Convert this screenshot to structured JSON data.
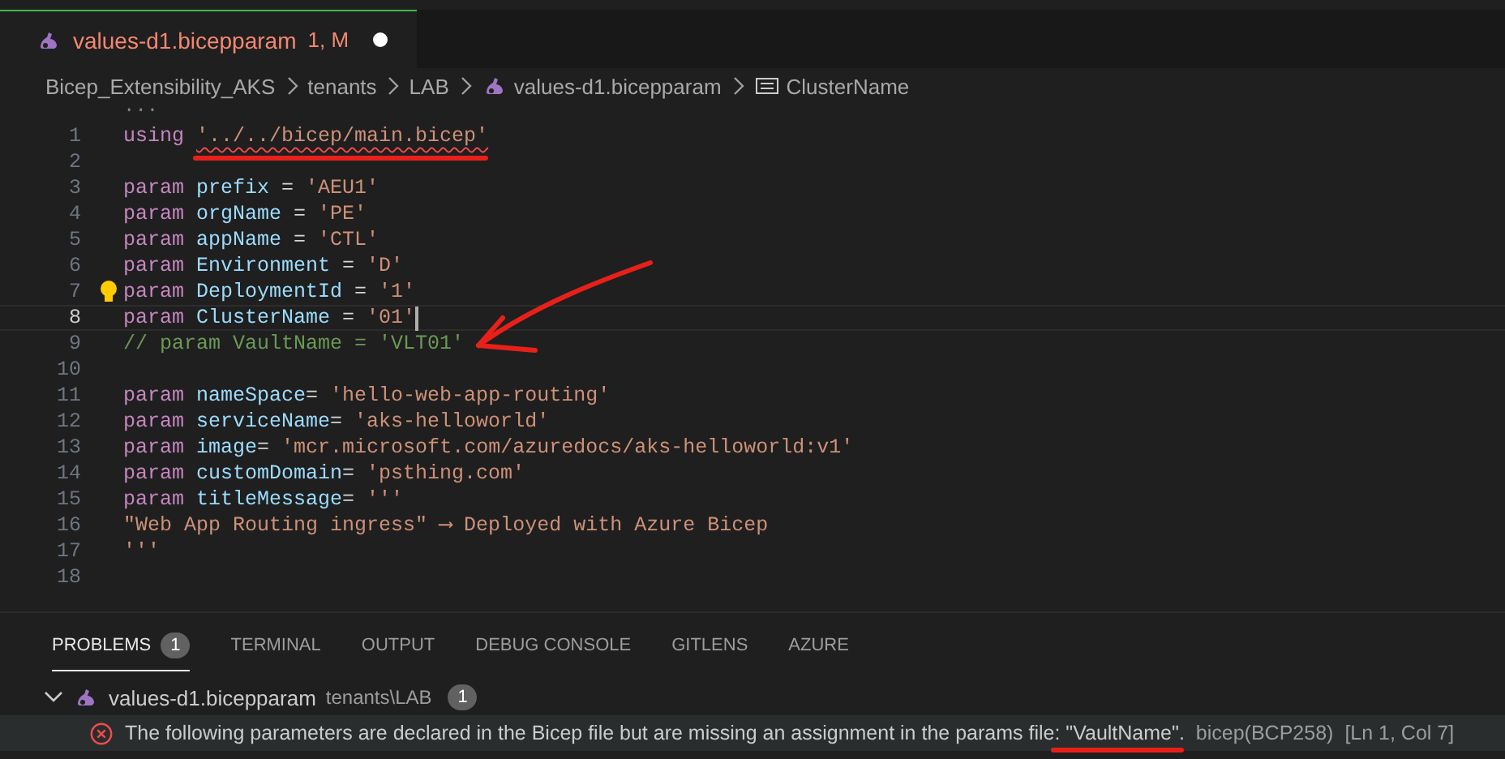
{
  "tabs": [
    {
      "label": "values-d1.bicepparam",
      "status": "1, M",
      "unsaved": true,
      "selected": true
    }
  ],
  "breadcrumb": [
    {
      "label": "Bicep_Extensibility_AKS",
      "kind": "folder"
    },
    {
      "label": "tenants",
      "kind": "folder"
    },
    {
      "label": "LAB",
      "kind": "folder"
    },
    {
      "label": "values-d1.bicepparam",
      "kind": "file"
    },
    {
      "label": "ClusterName",
      "kind": "symbol"
    }
  ],
  "editor": {
    "fold_marker": "···",
    "lines": [
      {
        "number": "1",
        "tokens": [
          {
            "kind": "keyword",
            "text": "using "
          },
          {
            "kind": "string",
            "text": "'../../bicep/main.bicep'",
            "error": true
          }
        ]
      },
      {
        "number": "2"
      },
      {
        "number": "3",
        "tokens": [
          {
            "kind": "keyword",
            "text": "param "
          },
          {
            "kind": "ident",
            "text": "prefix"
          },
          {
            "kind": "plain",
            "text": " = "
          },
          {
            "kind": "string",
            "text": "'AEU1'"
          }
        ]
      },
      {
        "number": "4",
        "tokens": [
          {
            "kind": "keyword",
            "text": "param "
          },
          {
            "kind": "ident",
            "text": "orgName"
          },
          {
            "kind": "plain",
            "text": " = "
          },
          {
            "kind": "string",
            "text": "'PE'"
          }
        ]
      },
      {
        "number": "5",
        "tokens": [
          {
            "kind": "keyword",
            "text": "param "
          },
          {
            "kind": "ident",
            "text": "appName"
          },
          {
            "kind": "plain",
            "text": " = "
          },
          {
            "kind": "string",
            "text": "'CTL'"
          }
        ]
      },
      {
        "number": "6",
        "tokens": [
          {
            "kind": "keyword",
            "text": "param "
          },
          {
            "kind": "ident",
            "text": "Environment"
          },
          {
            "kind": "plain",
            "text": " = "
          },
          {
            "kind": "string",
            "text": "'D'"
          }
        ]
      },
      {
        "number": "7",
        "lightbulb": true,
        "tokens": [
          {
            "kind": "keyword",
            "text": "param "
          },
          {
            "kind": "ident",
            "text": "DeploymentId"
          },
          {
            "kind": "plain",
            "text": " = "
          },
          {
            "kind": "string",
            "text": "'1'"
          }
        ]
      },
      {
        "number": "8",
        "current": true,
        "tokens": [
          {
            "kind": "keyword",
            "text": "param "
          },
          {
            "kind": "ident",
            "text": "ClusterName"
          },
          {
            "kind": "plain",
            "text": " = "
          },
          {
            "kind": "string",
            "text": "'01'"
          }
        ]
      },
      {
        "number": "9",
        "tokens": [
          {
            "kind": "comment",
            "text": "// param VaultName = 'VLT01'"
          }
        ]
      },
      {
        "number": "10"
      },
      {
        "number": "11",
        "tokens": [
          {
            "kind": "keyword",
            "text": "param "
          },
          {
            "kind": "ident",
            "text": "nameSpace"
          },
          {
            "kind": "plain",
            "text": "= "
          },
          {
            "kind": "string",
            "text": "'hello-web-app-routing'"
          }
        ]
      },
      {
        "number": "12",
        "tokens": [
          {
            "kind": "keyword",
            "text": "param "
          },
          {
            "kind": "ident",
            "text": "serviceName"
          },
          {
            "kind": "plain",
            "text": "= "
          },
          {
            "kind": "string",
            "text": "'aks-helloworld'"
          }
        ]
      },
      {
        "number": "13",
        "tokens": [
          {
            "kind": "keyword",
            "text": "param "
          },
          {
            "kind": "ident",
            "text": "image"
          },
          {
            "kind": "plain",
            "text": "= "
          },
          {
            "kind": "string",
            "text": "'mcr.microsoft.com/azuredocs/aks-helloworld:v1'"
          }
        ]
      },
      {
        "number": "14",
        "tokens": [
          {
            "kind": "keyword",
            "text": "param "
          },
          {
            "kind": "ident",
            "text": "customDomain"
          },
          {
            "kind": "plain",
            "text": "= "
          },
          {
            "kind": "string",
            "text": "'psthing.com'"
          }
        ]
      },
      {
        "number": "15",
        "tokens": [
          {
            "kind": "keyword",
            "text": "param "
          },
          {
            "kind": "ident",
            "text": "titleMessage"
          },
          {
            "kind": "plain",
            "text": "= "
          },
          {
            "kind": "string",
            "text": "'''"
          }
        ]
      },
      {
        "number": "16",
        "tokens": [
          {
            "kind": "string",
            "text": "\"Web App Routing ingress\" ⟶ Deployed with Azure Bicep"
          }
        ]
      },
      {
        "number": "17",
        "tokens": [
          {
            "kind": "string",
            "text": "'''"
          }
        ]
      },
      {
        "number": "18"
      }
    ]
  },
  "panel": {
    "tabs": [
      {
        "label": "PROBLEMS",
        "badge": "1",
        "selected": true
      },
      {
        "label": "TERMINAL",
        "selected": false
      },
      {
        "label": "OUTPUT",
        "selected": false
      },
      {
        "label": "DEBUG CONSOLE",
        "selected": false
      },
      {
        "label": "GITLENS",
        "selected": false
      },
      {
        "label": "AZURE",
        "selected": false
      }
    ],
    "file": {
      "name": "values-d1.bicepparam",
      "path": "tenants\\LAB",
      "count": "1",
      "expanded": true
    },
    "problems": [
      {
        "kind": "error",
        "message": "The following parameters are declared in the Bicep file but are missing an assignment in the params file: \"VaultName\".",
        "source": "bicep(BCP258)",
        "location": "[Ln 1, Col 7]",
        "selected": true
      }
    ]
  }
}
